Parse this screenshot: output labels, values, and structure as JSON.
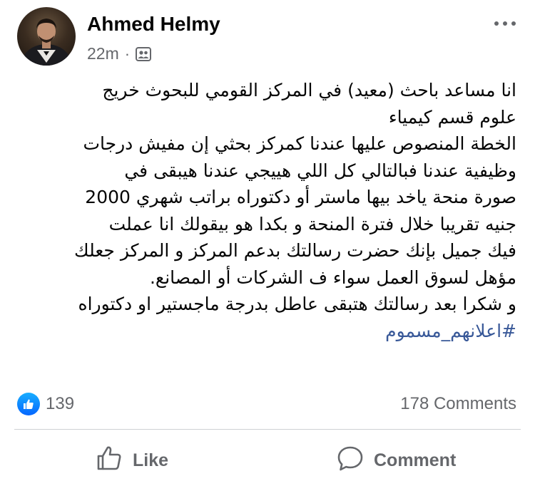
{
  "post": {
    "author": "Ahmed Helmy",
    "time": "22m",
    "separator": "·",
    "audience_icon": "friends-group-icon",
    "more_icon": "more-options-icon",
    "body_lines": [
      "انا مساعد باحث (معيد) في المركز القومي للبحوث خريج",
      "علوم قسم كيمياء",
      "الخطة المنصوص عليها عندنا كمركز بحثي إن مفيش درجات",
      "وظيفية عندنا فبالتالي كل اللي هييجي عندنا هيبقى في",
      "صورة منحة ياخد بيها ماستر أو دكتوراه براتب شهري 2000",
      "جنيه تقريبا خلال فترة المنحة و بكدا هو بيقولك انا عملت",
      "فيك جميل بإنك حضرت رسالتك بدعم المركز و المركز جعلك",
      "مؤهل لسوق العمل سواء ف الشركات أو المصانع.",
      "و شكرا بعد رسالتك هتبقى عاطل بدرجة ماجستير او دكتوراه"
    ],
    "hashtag": "#اعلانهم_مسموم"
  },
  "stats": {
    "reaction_icon": "like-reaction-icon",
    "reactions_count": "139",
    "comments": "178 Comments"
  },
  "actions": {
    "like_label": "Like",
    "like_icon": "thumbs-up-icon",
    "comment_label": "Comment",
    "comment_icon": "speech-bubble-icon"
  },
  "colors": {
    "hashtag": "#385898",
    "secondary_text": "#65676b",
    "like_blue": "#0566ff"
  }
}
